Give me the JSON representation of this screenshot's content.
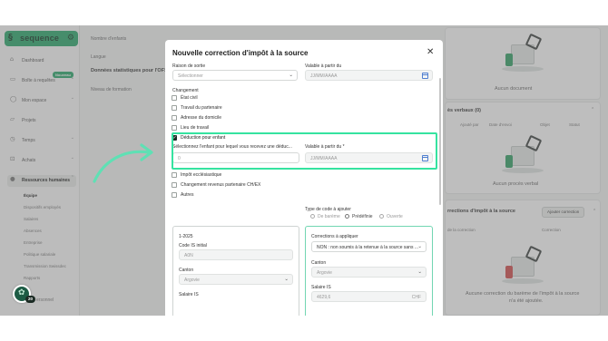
{
  "sidebar": {
    "brand": "sequence",
    "items": [
      {
        "label": "Dashboard",
        "icon": "home-icon"
      },
      {
        "label": "Boîte à requêtes",
        "icon": "inbox-icon",
        "badge": "Nouveau"
      },
      {
        "label": "Mon espace",
        "icon": "user-icon"
      },
      {
        "label": "Projets",
        "icon": "folder-icon"
      },
      {
        "label": "Temps",
        "icon": "clock-icon"
      },
      {
        "label": "Achats",
        "icon": "cart-icon"
      },
      {
        "label": "Ressources humaines",
        "icon": "people-icon"
      }
    ],
    "subitems": [
      "Équipe",
      "Dispositifs employés",
      "Salaires",
      "Absences",
      "Entreprise",
      "Politique salariale",
      "Transmission Swissdec",
      "Rapports"
    ],
    "bottom_label": "ersonnel",
    "help_count": "20"
  },
  "background": {
    "fields": {
      "children_label": "Nombre d'enfants",
      "language_label": "Langue",
      "stats_title": "Données statistiques pour l'OFS",
      "education_label": "Niveau de formation"
    },
    "documents_empty": "Aucun document",
    "pv_title": "ès verbaux (0)",
    "pv_columns": [
      "Ajouté par",
      "Date d'envoi",
      "Objet",
      "Statut"
    ],
    "pv_empty": "Aucun procès verbal",
    "corrections_title": "rrections d'impôt à la source",
    "corrections_button": "Ajouter correction",
    "corrections_columns": [
      "de la correction",
      "Correction"
    ],
    "corrections_empty_line1": "Aucune correction du barème de l'impôt à la source",
    "corrections_empty_line2": "n'a été ajoutée."
  },
  "modal": {
    "title": "Nouvelle correction d'impôt à la source",
    "reason_label": "Raison de sortie",
    "reason_placeholder": "Sélectionner",
    "valid_from_label": "Valable à partir du",
    "date_placeholder": "JJ/MM/AAAA",
    "change_label": "Changement",
    "changes": [
      {
        "label": "État civil",
        "checked": false
      },
      {
        "label": "Travail du partenaire",
        "checked": false
      },
      {
        "label": "Adresse du domicile",
        "checked": false
      },
      {
        "label": "Lieu de travail",
        "checked": false
      },
      {
        "label": "Déduction pour enfant",
        "checked": true
      }
    ],
    "child_select_label": "Sélectionnez l'enfant pour lequel vous recevez une déduc...",
    "child_value": "0",
    "child_valid_label": "Valable à partir du *",
    "more_changes": [
      {
        "label": "Impôt ecclésiastique",
        "checked": false
      },
      {
        "label": "Changement revenus partenaire CH/EX",
        "checked": false
      },
      {
        "label": "Autres",
        "checked": false
      }
    ],
    "code_type_label": "Type de code à ajouter",
    "code_types": [
      {
        "label": "De barème",
        "selected": false
      },
      {
        "label": "Prédéfinie",
        "selected": true
      },
      {
        "label": "Ouverte",
        "selected": false
      }
    ],
    "left_panel": {
      "period": "1-2025",
      "code_label": "Code IS initial",
      "code_value": "A0N",
      "canton_label": "Canton",
      "canton_value": "Argovie",
      "salary_label": "Salaire IS"
    },
    "right_panel": {
      "title": "Corrections à appliquer",
      "correction_value": "NON : non soumis à la retenue à la source sans ...",
      "canton_label": "Canton",
      "canton_value": "Argovie",
      "salary_label": "Salaire IS",
      "salary_value": "4629,6",
      "salary_unit": "CHF"
    }
  },
  "colors": {
    "brand": "#25a768",
    "highlight": "#35e3a0",
    "arrow": "#5fe0b4",
    "checkbox_checked": "#1b2b24"
  }
}
